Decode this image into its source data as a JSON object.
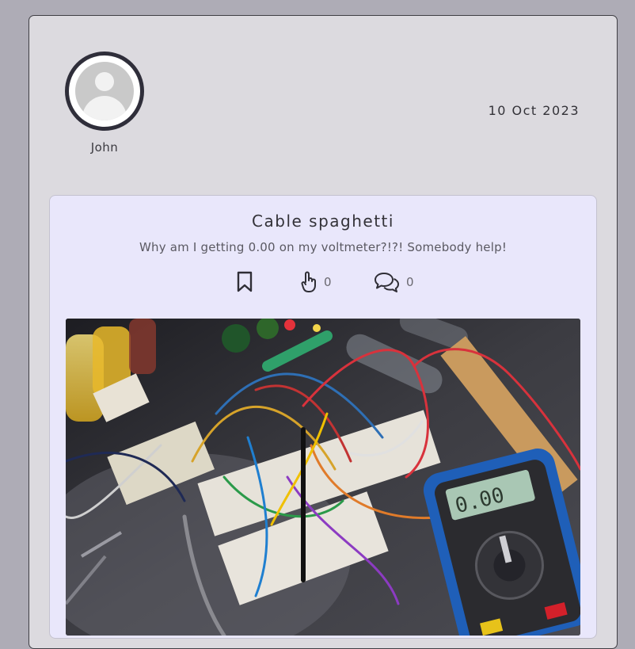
{
  "post": {
    "author": {
      "name": "John"
    },
    "date": "10 Oct 2023",
    "title": "Cable spaghetti",
    "body": "Why am I getting 0.00 on my voltmeter?!?! Somebody help!",
    "likes_count": "0",
    "comments_count": "0",
    "image": {
      "subject": "breadboard circuits, wires and multimeter",
      "multimeter_display": "0.00"
    }
  },
  "colors": {
    "page_bg": "#aeacb6",
    "card_bg": "#dcdadf",
    "content_bg": "#e9e7fb",
    "text": "#333238"
  }
}
